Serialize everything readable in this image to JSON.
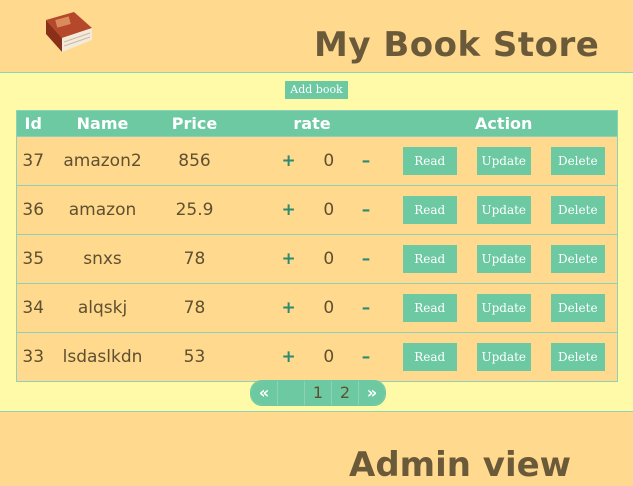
{
  "header": {
    "title": "My Book Store"
  },
  "toolbar": {
    "add_label": "Add book"
  },
  "table": {
    "columns": {
      "id": "Id",
      "name": "Name",
      "price": "Price",
      "rate": "rate",
      "action": "Action"
    },
    "rows": [
      {
        "id": "37",
        "name": "amazon2",
        "price": "856",
        "rate": "0"
      },
      {
        "id": "36",
        "name": "amazon",
        "price": "25.9",
        "rate": "0"
      },
      {
        "id": "35",
        "name": "snxs",
        "price": "78",
        "rate": "0"
      },
      {
        "id": "34",
        "name": "alqskj",
        "price": "78",
        "rate": "0"
      },
      {
        "id": "33",
        "name": "lsdaslkdn",
        "price": "53",
        "rate": "0"
      }
    ],
    "rate_plus": "+",
    "rate_minus": "–",
    "actions": {
      "read": "Read",
      "update": "Update",
      "delete": "Delete"
    }
  },
  "pagination": {
    "first": "«",
    "pages": [
      "1",
      "2"
    ],
    "last": "»"
  },
  "footer": {
    "title": "Admin view"
  },
  "colors": {
    "accent": "#6cc9a2",
    "background": "#ffd98e",
    "panel": "#fffaa8",
    "title_text": "#6b5a3a"
  }
}
